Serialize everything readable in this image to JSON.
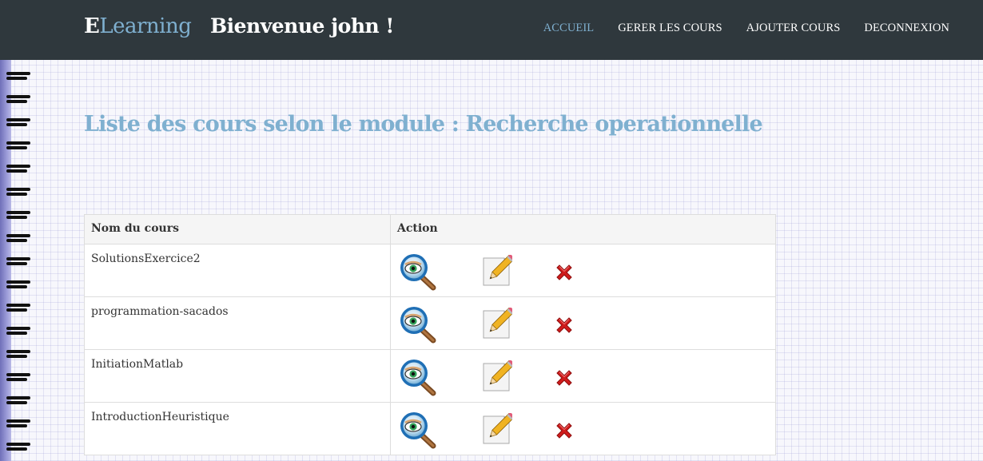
{
  "header": {
    "brand_first": "E",
    "brand_rest": "Learning",
    "welcome": "Bienvenue  john !",
    "nav": [
      {
        "label": "ACCUEIL",
        "active": true
      },
      {
        "label": "GERER LES COURS",
        "active": false
      },
      {
        "label": "AJOUTER COURS",
        "active": false
      },
      {
        "label": "DECONNEXION",
        "active": false
      }
    ]
  },
  "main": {
    "title": "Liste des cours selon le module :  Recherche operationnelle",
    "table": {
      "headers": [
        "Nom du cours",
        "Action"
      ],
      "rows": [
        {
          "name": "SolutionsExercice2"
        },
        {
          "name": "programmation-sacados"
        },
        {
          "name": "InitiationMatlab"
        },
        {
          "name": "IntroductionHeuristique"
        }
      ],
      "action_icons": [
        "view-icon",
        "edit-icon",
        "delete-icon"
      ]
    }
  },
  "colors": {
    "navbar_bg": "#2f383d",
    "accent": "#7fb0d0",
    "delete_red": "#cc1f1f"
  }
}
